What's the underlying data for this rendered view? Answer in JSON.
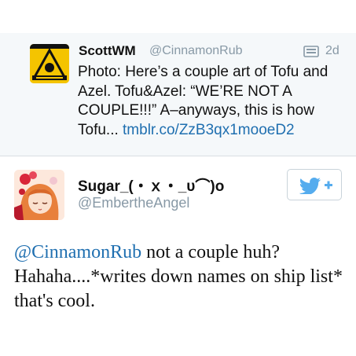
{
  "parent_tweet": {
    "name": "ScottWM",
    "handle": "@CinnamonRub",
    "time": "2d",
    "text_before_link": "Photo: Here’s a couple art of Tofu and Azel. Tofu&Azel: “WE’RE NOT A COUPLE!!!” A–anyways, this is how Tofu...",
    "link": "tmblr.co/ZzB3qx1mooeD2",
    "avatar_color": "#f4c400"
  },
  "reply_tweet": {
    "name": "Sugar_(・ｘ・_υ⌒)o",
    "handle": "@EmbertheAngel",
    "mention": "@CinnamonRub",
    "text": " not a couple huh? Hahaha....*writes down names on ship list* that's cool.",
    "follow_icon": "twitter-bird-plus-icon"
  },
  "colors": {
    "link": "#1f6fb0",
    "handle": "#8899a6",
    "twitter_blue": "#55acee",
    "parent_bg": "#f5f8fa"
  }
}
